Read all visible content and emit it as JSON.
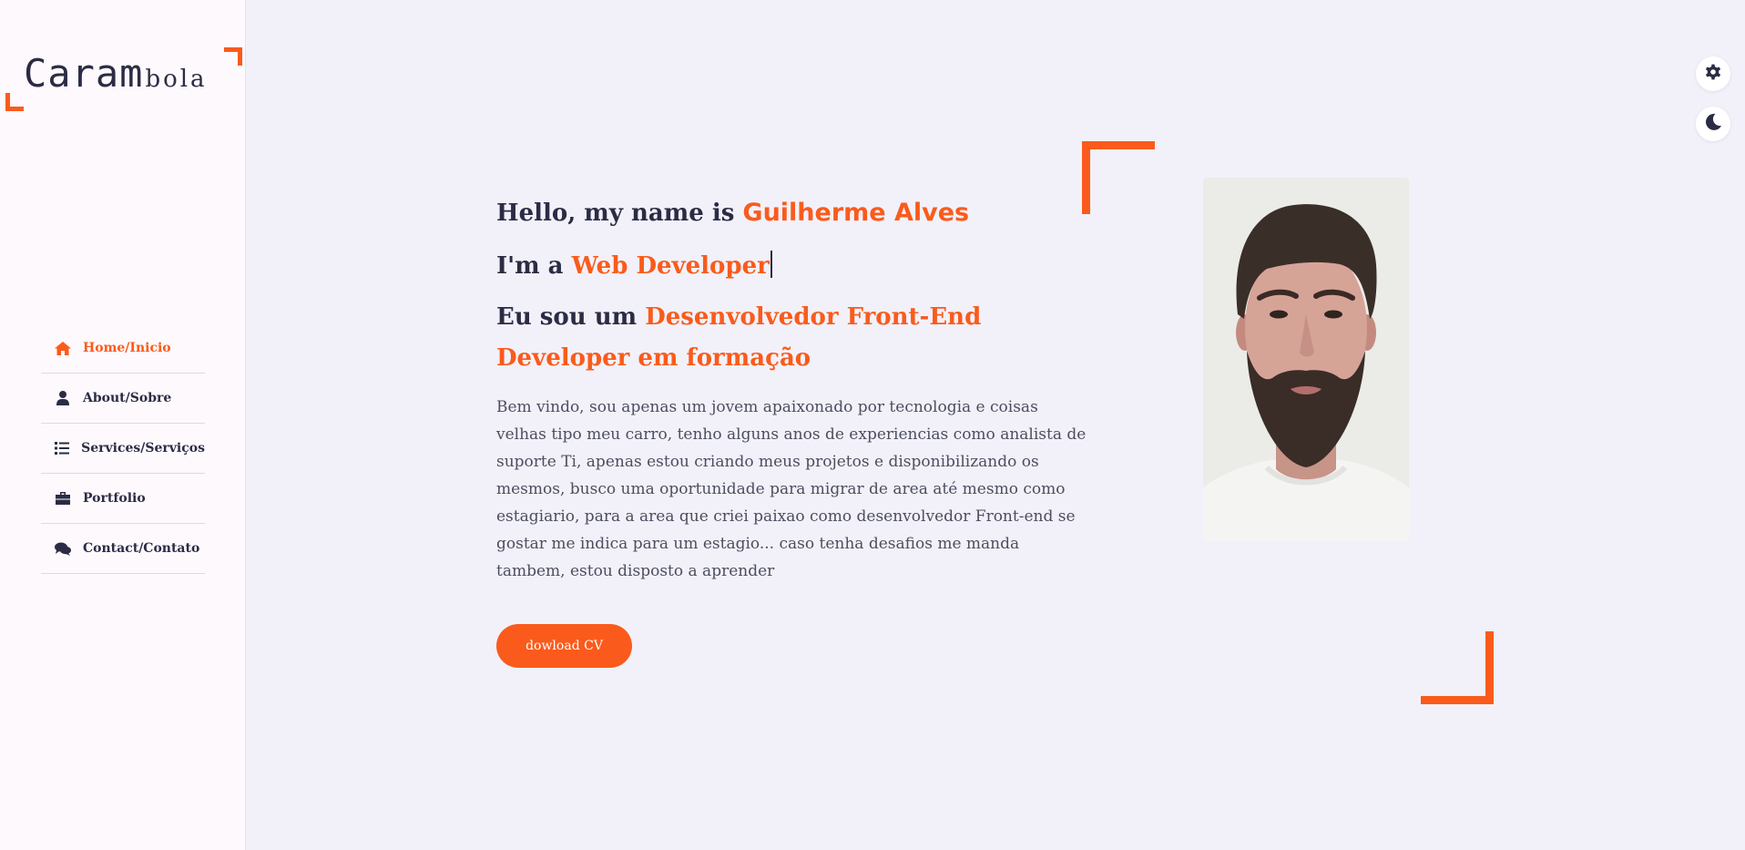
{
  "brand": {
    "logo_big": "Caram",
    "logo_small": "bola",
    "accent_color": "#fa5b1c",
    "text_color": "#2b2c44"
  },
  "sidebar": {
    "items": [
      {
        "label": "Home/Inicio",
        "icon": "home-icon",
        "active": true
      },
      {
        "label": "About/Sobre",
        "icon": "user-icon",
        "active": false
      },
      {
        "label": "Services/Serviços",
        "icon": "list-icon",
        "active": false
      },
      {
        "label": "Portfolio",
        "icon": "briefcase-icon",
        "active": false
      },
      {
        "label": "Contact/Contato",
        "icon": "comments-icon",
        "active": false
      }
    ]
  },
  "controls": {
    "settings_icon": "gear-icon",
    "theme_icon": "moon-icon"
  },
  "hero": {
    "greeting_prefix": "Hello, my name is ",
    "name": "Guilherme Alves",
    "role_prefix": "I'm a ",
    "role": "Web Developer",
    "pt_prefix": "Eu sou um ",
    "pt_role": "Desenvolvedor Front-End Developer em formação",
    "intro": "Bem vindo, sou apenas um jovem apaixonado por tecnologia e coisas velhas tipo meu carro, tenho alguns anos de experiencias como analista de suporte Ti, apenas estou criando meus projetos e disponibilizando os mesmos, busco uma oportunidade para migrar de area até mesmo como estagiario, para a area que criei paixao como desenvolvedor Front-end se gostar me indica para um estagio... caso tenha desafios me manda tambem, estou disposto a aprender",
    "cv_button": "dowload CV"
  }
}
